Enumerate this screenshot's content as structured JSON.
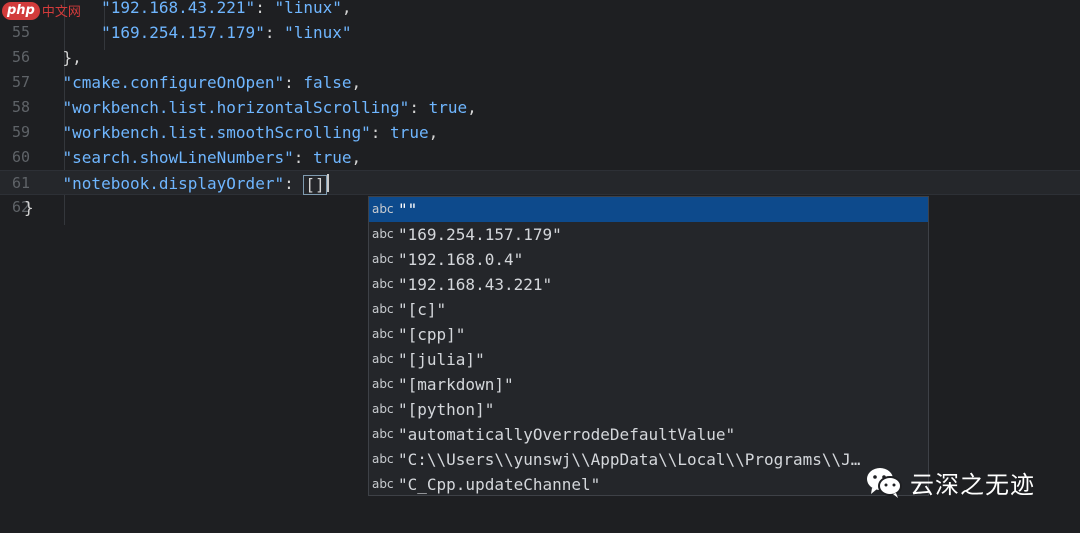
{
  "editor": {
    "lines": [
      {
        "num": "",
        "indent": "        ",
        "key": "\"192.168.43.221\"",
        "sep": ": ",
        "value": "\"linux\"",
        "value_type": "str",
        "tail": ","
      },
      {
        "num": "55",
        "indent": "        ",
        "key": "\"169.254.157.179\"",
        "sep": ": ",
        "value": "\"linux\"",
        "value_type": "str",
        "tail": ""
      },
      {
        "num": "56",
        "indent": "    ",
        "key": "",
        "sep": "",
        "value": "",
        "value_type": "",
        "tail": "},"
      },
      {
        "num": "57",
        "indent": "    ",
        "key": "\"cmake.configureOnOpen\"",
        "sep": ": ",
        "value": "false",
        "value_type": "kw",
        "tail": ","
      },
      {
        "num": "58",
        "indent": "    ",
        "key": "\"workbench.list.horizontalScrolling\"",
        "sep": ": ",
        "value": "true",
        "value_type": "kw",
        "tail": ","
      },
      {
        "num": "59",
        "indent": "    ",
        "key": "\"workbench.list.smoothScrolling\"",
        "sep": ": ",
        "value": "true",
        "value_type": "kw",
        "tail": ","
      },
      {
        "num": "60",
        "indent": "    ",
        "key": "\"search.showLineNumbers\"",
        "sep": ": ",
        "value": "true",
        "value_type": "kw",
        "tail": ","
      },
      {
        "num": "61",
        "indent": "    ",
        "key": "\"notebook.displayOrder\"",
        "sep": ": ",
        "value": "[]",
        "value_type": "bracket",
        "tail": ""
      },
      {
        "num": "62",
        "indent": "",
        "key": "",
        "sep": "",
        "value": "",
        "value_type": "",
        "tail": "}"
      }
    ],
    "current_line_index": 7
  },
  "suggestions": {
    "kind_label": "abc",
    "selected_index": 0,
    "items": [
      "\"\"",
      "\"169.254.157.179\"",
      "\"192.168.0.4\"",
      "\"192.168.43.221\"",
      "\"[c]\"",
      "\"[cpp]\"",
      "\"[julia]\"",
      "\"[markdown]\"",
      "\"[python]\"",
      "\"automaticallyOverrodeDefaultValue\"",
      "\"C:\\\\Users\\\\yunswj\\\\AppData\\\\Local\\\\Programs\\\\J…",
      "\"C_Cpp.updateChannel\""
    ]
  },
  "watermarks": {
    "top_left_badge": "php",
    "top_left_text": "中文网",
    "bottom_right_text": "云深之无迹",
    "bottom_right_icon": "wechat-icon"
  },
  "colors": {
    "background": "#1e1f22",
    "string": "#6fb6ff",
    "selection": "#0d4a8c",
    "line_number": "#5f6368"
  }
}
